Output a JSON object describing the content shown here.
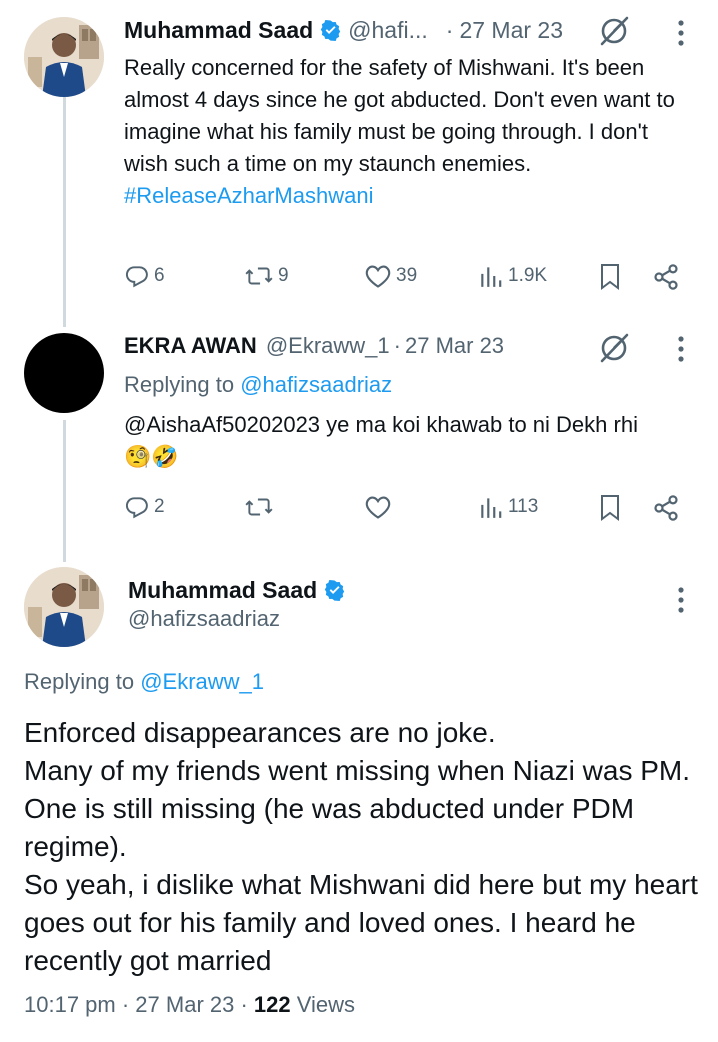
{
  "tweet1": {
    "author_name": "Muhammad Saad",
    "handle": "@hafi...",
    "sep": "·",
    "date": "27 Mar 23",
    "text": "Really concerned for the safety of Mishwani. It's been almost 4 days since he got abducted. Don't even want to imagine what his family must be going through. I don't wish such a time on my staunch enemies.",
    "hashtag": "#ReleaseAzharMashwani",
    "replies": "6",
    "reposts": "9",
    "likes": "39",
    "views": "1.9K"
  },
  "tweet2": {
    "author_name": "EKRA AWAN",
    "handle": "@Ekraww_1",
    "sep": "·",
    "date": "27 Mar 23",
    "replying_prefix": "Replying to ",
    "replying_handle": "@hafizsaadriaz",
    "text": "@AishaAf50202023 ye ma koi khawab to ni Dekh rhi",
    "emoji": "🧐🤣",
    "replies": "2",
    "views": "113"
  },
  "main": {
    "author_name": "Muhammad Saad",
    "handle": "@hafizsaadriaz",
    "replying_prefix": "Replying to ",
    "replying_handle": "@Ekraww_1",
    "text": "Enforced disappearances are no joke.\nMany of my friends went missing when Niazi was PM. One is still missing (he was abducted under PDM regime).\nSo yeah, i dislike what Mishwani did here but my heart goes out for his family and loved ones. I heard he recently got married",
    "time": "10:17 pm",
    "sep1": " · ",
    "date": "27 Mar 23",
    "sep2": " · ",
    "views_count": "122",
    "views_label": " Views"
  },
  "colors": {
    "accent": "#1d9bf0",
    "secondary_text": "#536471",
    "primary_text": "#0f1419"
  }
}
